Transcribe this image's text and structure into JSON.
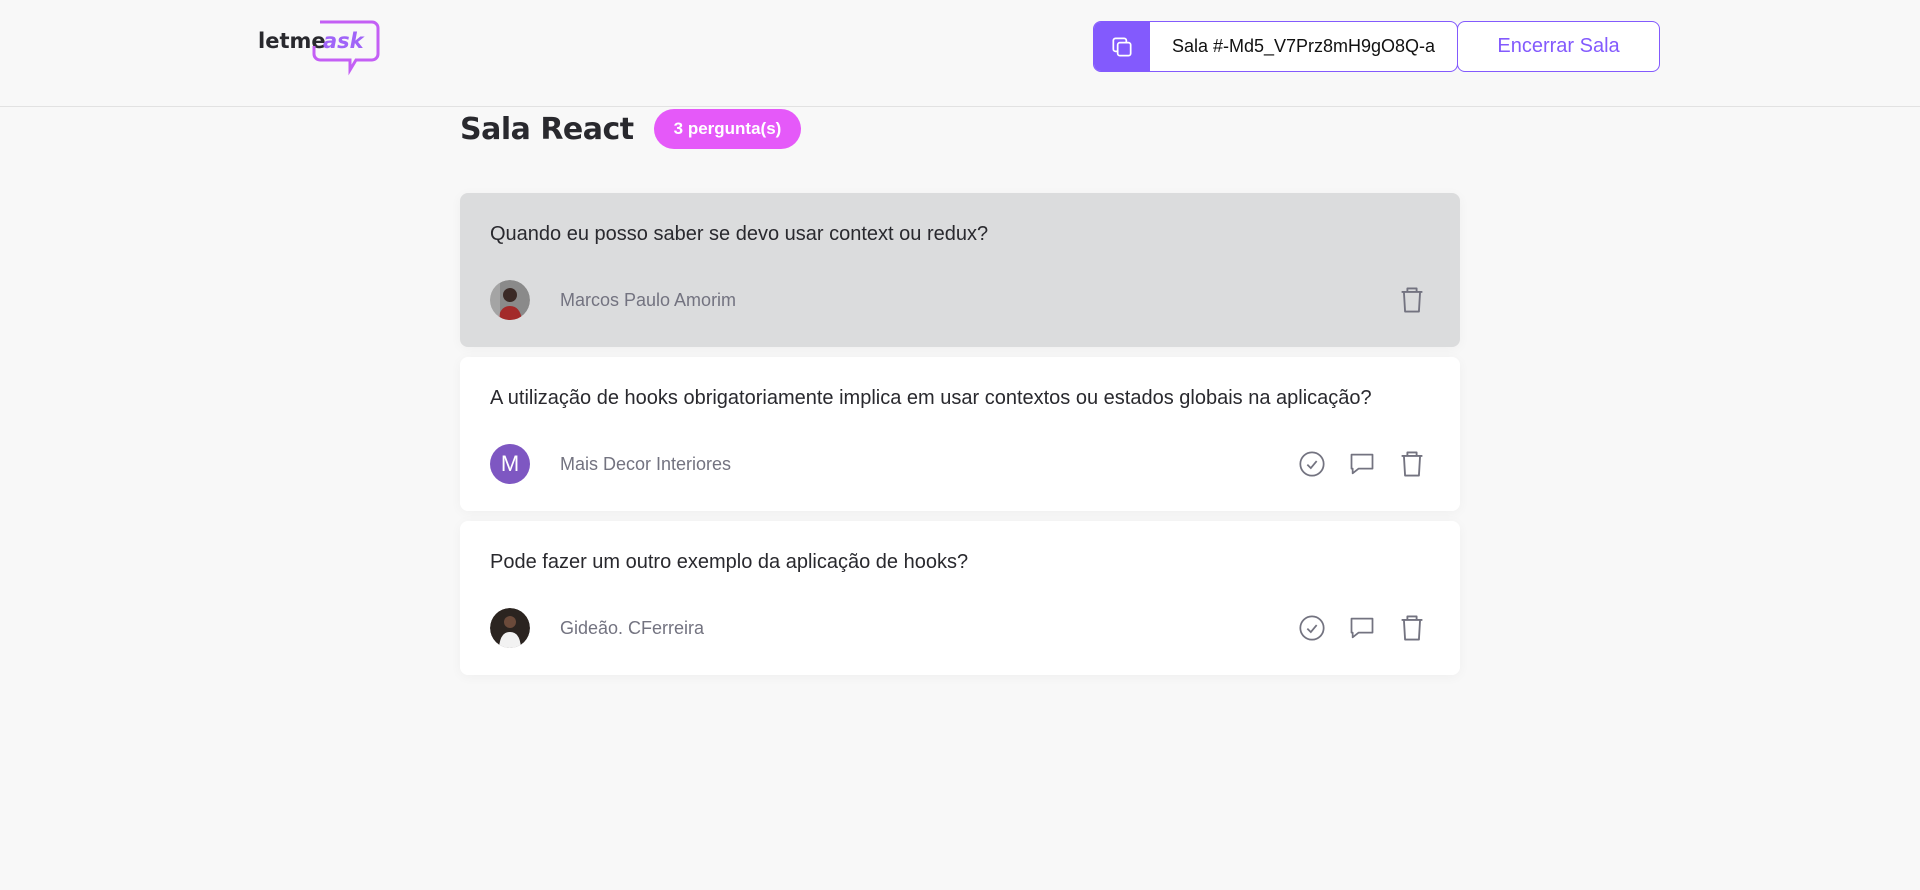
{
  "header": {
    "logo_text": "letmeask",
    "room_code_label": "Sala #-Md5_V7Prz8mH9gO8Q-a",
    "close_room_label": "Encerrar Sala"
  },
  "room": {
    "title": "Sala React",
    "question_count_label": "3 pergunta(s)"
  },
  "questions": [
    {
      "content": "Quando eu posso saber se devo usar context ou redux?",
      "author": "Marcos Paulo Amorim",
      "highlighted": true,
      "avatar_icon": "photo-avatar",
      "actions": [
        "trash-icon"
      ]
    },
    {
      "content": "A utilização de hooks obrigatoriamente implica em usar contextos ou estados globais na aplicação?",
      "author": "Mais Decor Interiores",
      "avatar_letter": "M",
      "highlighted": false,
      "actions": [
        "check-circle-icon",
        "chat-icon",
        "trash-icon"
      ]
    },
    {
      "content": "Pode fazer um outro exemplo da aplicação de hooks?",
      "author": "Gideão. CFerreira",
      "highlighted": false,
      "avatar_icon": "photo-avatar",
      "actions": [
        "check-circle-icon",
        "chat-icon",
        "trash-icon"
      ]
    }
  ],
  "colors": {
    "accent": "#835afd",
    "badge": "#e559f9",
    "highlight": "#dbdcdd"
  }
}
